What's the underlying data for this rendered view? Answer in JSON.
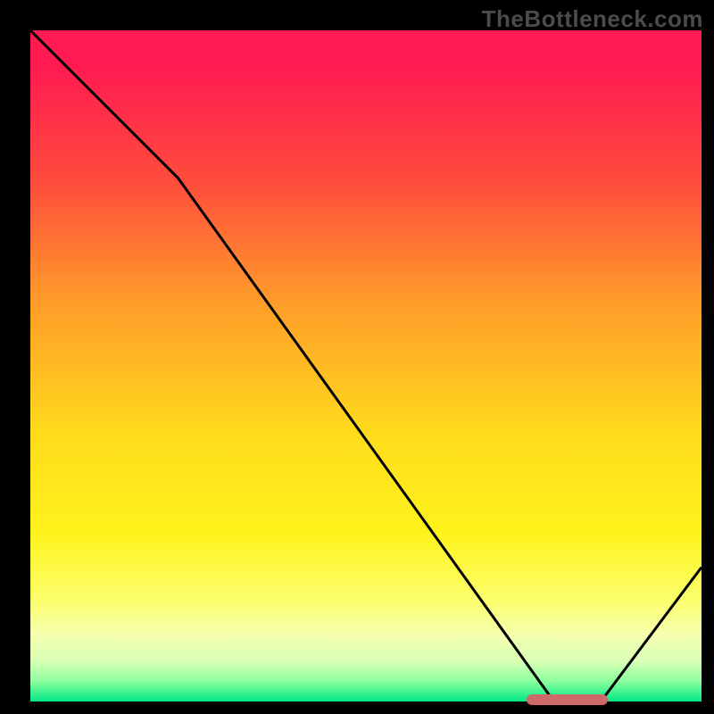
{
  "watermark": "TheBottleneck.com",
  "colors": {
    "frame_bg": "#000000",
    "curve": "#000000",
    "marker": "#cf6a6a",
    "gradient_top": "#ff1a52",
    "gradient_bottom": "#00e884"
  },
  "chart_data": {
    "type": "line",
    "title": "",
    "xlabel": "",
    "ylabel": "",
    "xlim": [
      0,
      100
    ],
    "ylim": [
      0,
      100
    ],
    "x": [
      0,
      22,
      78,
      85,
      100
    ],
    "values": [
      100,
      78,
      0,
      0,
      20
    ],
    "marker_segment": {
      "x_start": 74,
      "x_end": 86,
      "y": 0
    },
    "annotations": [],
    "grid": false,
    "legend": null
  }
}
